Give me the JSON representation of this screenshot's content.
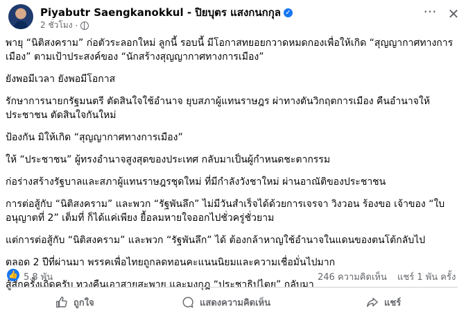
{
  "post": {
    "author": "Piyabutr Saengkanokkul - ปิยบุตร แสงกนกกุล",
    "time": "2 ชั่วโมง",
    "dot": "·"
  },
  "header_icons": {
    "more": "more-icon",
    "close": "close-icon",
    "verified": "verified-badge",
    "privacy": "globe-icon"
  },
  "content": {
    "paragraphs": [
      "พายุ “นิติสงคราม” ก่อตัวระลอกใหม่ ลูกนี้ รอบนี้ มีโอกาสทยอยกวาดหมดกองเพื่อให้เกิด “สุญญากาศทางการ\nเมือง” ตามเป้าประสงค์ของ “นักสร้างสุญญากาศทางการเมือง”",
      "ยังพอมีเวลา ยังพอมีโอกาส",
      "รักษาการนายกรัฐมนตรี ตัดสินใจใช้อำนาจ ยุบสภาผู้แทนราษฎร ผ่าทางตันวิกฤตการเมือง คืนอำนาจให้\nประชาชน ตัดสินใจกันใหม่",
      "ป้องกัน มิให้เกิด “สุญญากาศทางการเมือง”",
      "ให้ “ประชาชน” ผู้ทรงอำนาจสูงสุดของประเทศ กลับมาเป็นผู้กำหนดชะตากรรม",
      "ก่อร่างสร้างรัฐบาลและสภาผู้แทนราษฎรชุดใหม่ ที่มีกำลังวังชาใหม่ ผ่านอาณัติของประชาชน",
      "การต่อสู้กับ “นิติสงคราม” และพวก “รัฐพันลึก” ไม่มีวันสำเร็จได้ด้วยการเจรจา วิงวอน ร้องขอ เจ้าของ “ใบ\nอนุญาตที่ 2” เต็มที่ ก็ได้แค่เพียง ยื้อลมหายใจออกไปชั่วครู่ชั่วยาม",
      "แต่การต่อสู้กับ “นิติสงคราม” และพวก “รัฐพันลึก” ได้ ต้องกล้าหาญใช้อำนาจในแดนของตนโต้กลับไป",
      "ตลอด 2 ปีที่ผ่านมา พรรคเพื่อไทยถูกลดทอนคะแนนนิยมและความเชื่อมั่นไปมาก",
      "สู้สักครั้งเถิดครับ ทวงคืนเอาสายสะพาย และมงกุฎ “ประชาธิปไตย” กลับมา"
    ]
  },
  "stats": {
    "reactions": "5.8 พัน",
    "comments": "246 ความคิดเห็น",
    "shares": "แชร์ 1 พัน ครั้ง"
  },
  "actions": {
    "like": "ถูกใจ",
    "comment": "แสดงความคิดเห็น",
    "share": "แชร์"
  },
  "colors": {
    "brand": "#1877f2",
    "secondary_text": "#65676b",
    "divider": "#ced0d4"
  }
}
